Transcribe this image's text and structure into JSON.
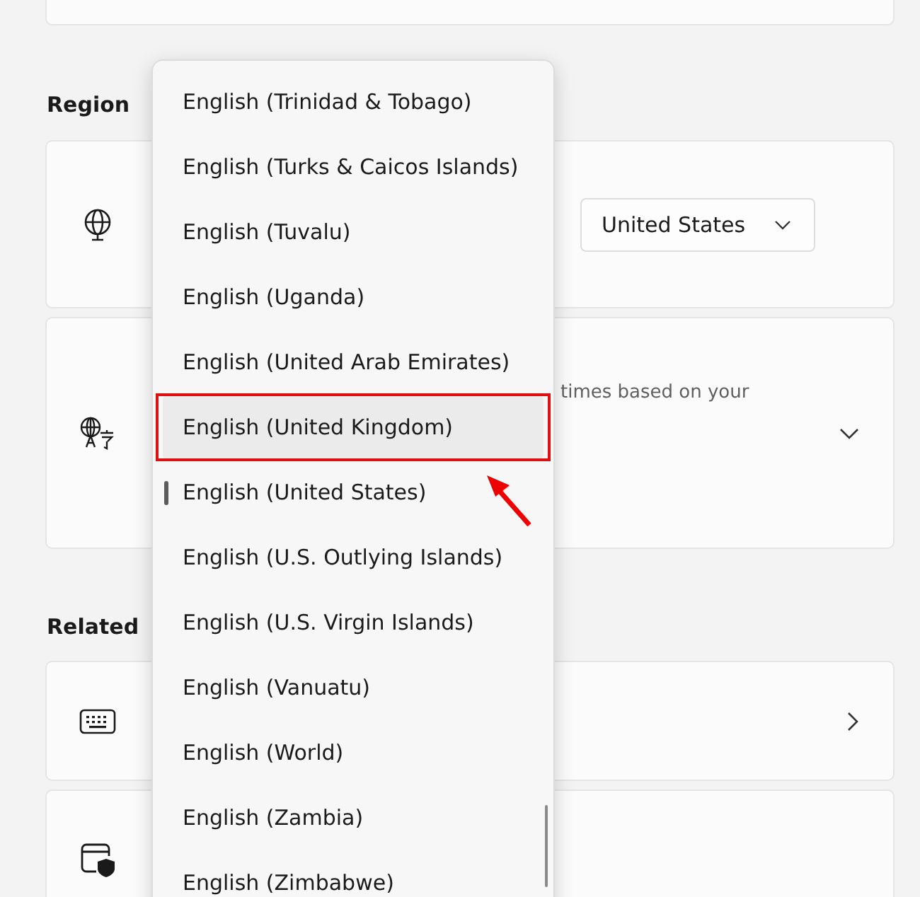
{
  "region": {
    "heading": "Region",
    "settings": [
      {
        "kind": "dropdown",
        "value": "United States"
      },
      {
        "kind": "expand",
        "description": "times based on your"
      }
    ]
  },
  "related": {
    "heading": "Related",
    "settings": [
      {
        "kind": "link"
      },
      {
        "kind": "plain"
      }
    ]
  },
  "dropdown": {
    "items": [
      {
        "label": "English (Trinidad & Tobago)",
        "selected": false,
        "hovered": false
      },
      {
        "label": "English (Turks & Caicos Islands)",
        "selected": false,
        "hovered": false
      },
      {
        "label": "English (Tuvalu)",
        "selected": false,
        "hovered": false
      },
      {
        "label": "English (Uganda)",
        "selected": false,
        "hovered": false
      },
      {
        "label": "English (United Arab Emirates)",
        "selected": false,
        "hovered": false
      },
      {
        "label": "English (United Kingdom)",
        "selected": false,
        "hovered": true
      },
      {
        "label": "English (United States)",
        "selected": true,
        "hovered": false
      },
      {
        "label": "English (U.S. Outlying Islands)",
        "selected": false,
        "hovered": false
      },
      {
        "label": "English (U.S. Virgin Islands)",
        "selected": false,
        "hovered": false
      },
      {
        "label": "English (Vanuatu)",
        "selected": false,
        "hovered": false
      },
      {
        "label": "English (World)",
        "selected": false,
        "hovered": false
      },
      {
        "label": "English (Zambia)",
        "selected": false,
        "hovered": false
      },
      {
        "label": "English (Zimbabwe)",
        "selected": false,
        "hovered": false
      }
    ]
  }
}
